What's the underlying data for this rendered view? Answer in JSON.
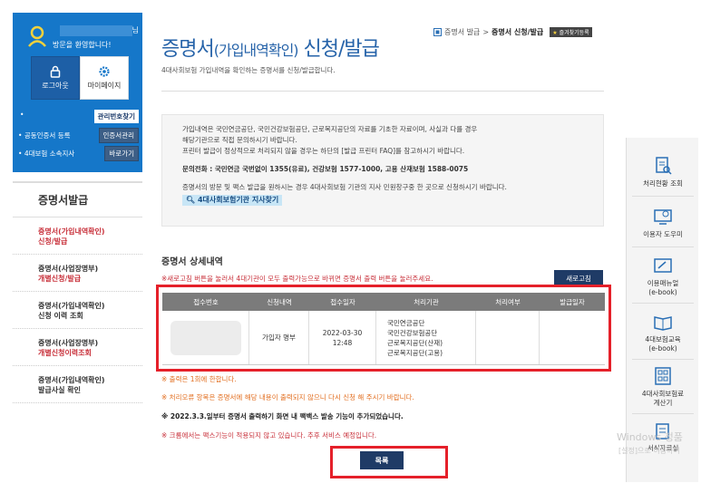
{
  "user": {
    "suffix": "님",
    "welcome": "방문을 환영합니다!",
    "logout_label": "로그아웃",
    "mypage_label": "마이페이지",
    "find_id_label": "관리번호찾기",
    "cert_label": "공동인증서 등록",
    "cert_button": "인증서관리",
    "affiliation_label": "4대보험 소속지사",
    "shortcut_button": "바로가기"
  },
  "menu": {
    "title": "증명서발급",
    "items": [
      {
        "line1": "증명서(가입내역확인)",
        "line2": "신청/발급"
      },
      {
        "line1": "증명서(사업장명부)",
        "line2": "개별신청/발급"
      },
      {
        "line1": "증명서(가입내역확인)",
        "line2": "신청 이력 조회"
      },
      {
        "line1": "증명서(사업장명부)",
        "line2": "개별신청이력조회"
      },
      {
        "line1": "증명서(가입내역확인)",
        "line2": "발급사실 확인"
      }
    ]
  },
  "header": {
    "title_main": "증명서",
    "title_paren": "(가입내역확인)",
    "title_tail": " 신청/발급",
    "description": "4대사회보험 가입내역을 확인하는 증명서를 신청/발급합니다.",
    "breadcrumb_parent": "증명서 발급",
    "breadcrumb_sep": ">",
    "breadcrumb_current": "증명서 신청/발급",
    "favorite": "즐겨찾기등록"
  },
  "info": {
    "line1": "가입내역은 국민연금공단, 국민건강보험공단, 근로복지공단의 자료를 기초한 자료이며, 사실과 다를 경우",
    "line2": "해당기관으로 직접 문의하시기 바랍니다.",
    "line3": "프린터 발급이 정상적으로 처리되지 않을 경우는 하단의 [발급 프린터 FAQ]를 참고하시기 바랍니다.",
    "contact": "문의전화 : 국민연금 국번없이 1355(유료), 건강보험 1577-1000, 고용 산재보험 1588-0075",
    "visit": "증명서의 방문 및 팩스 발급을 원하시는 경우 4대사회보험 기관의 지사 민원창구중 한 곳으로 신청하시기 바랍니다.",
    "find_branch": "4대사회보험기관 지사찾기"
  },
  "detail": {
    "title": "증명서 상세내역",
    "notice": "※새로고침 버튼을 눌러서 4대기관이 모두 출력가능으로 바뀌면 증명서 출력 버튼을 눌러주세요.",
    "refresh_label": "새로고침",
    "columns": [
      "접수번호",
      "신청내역",
      "접수일자",
      "처리기관",
      "처리여부",
      "발급일자"
    ],
    "row": {
      "type": "가입자 명부",
      "date": "2022-03-30",
      "time": "12:48",
      "agencies": [
        "국민연금공단",
        "국민건강보험공단",
        "근로복지공단(산재)",
        "근로복지공단(고용)"
      ]
    }
  },
  "notes": {
    "n1": "※ 출력은 1회에 한합니다.",
    "n2": "※ 처리오류 항목은 증명서에 해당 내용이 출력되지 않으니 다시 신청 해 주시기 바랍니다.",
    "n3": "※ 2022.3.3.일부터 증명서 출력하기 화면 내 팩백스 발송 기능이 추가되었습니다.",
    "n4": "※ 크롬에서는 팩스기능이 적용되지 않고 있습니다. 추후 서비스 예정입니다."
  },
  "list_button": "목록",
  "quick": {
    "items": [
      {
        "label1": "처리현황 조회",
        "label2": ""
      },
      {
        "label1": "이용자 도우미",
        "label2": ""
      },
      {
        "label1": "이용매뉴얼",
        "label2": "(e-book)"
      },
      {
        "label1": "4대보험교육",
        "label2": "(e-book)"
      },
      {
        "label1": "4대사회보험료",
        "label2": "계산기"
      },
      {
        "label1": "서식자료실",
        "label2": ""
      }
    ]
  },
  "watermark": {
    "line1": "Windows 정품",
    "line2": "[설정]으로 이동하여"
  },
  "colors": {
    "brand_blue": "#1577c9",
    "title_blue": "#2663a9",
    "highlight_red": "#e5202a",
    "dark_navy": "#1f3b66"
  }
}
